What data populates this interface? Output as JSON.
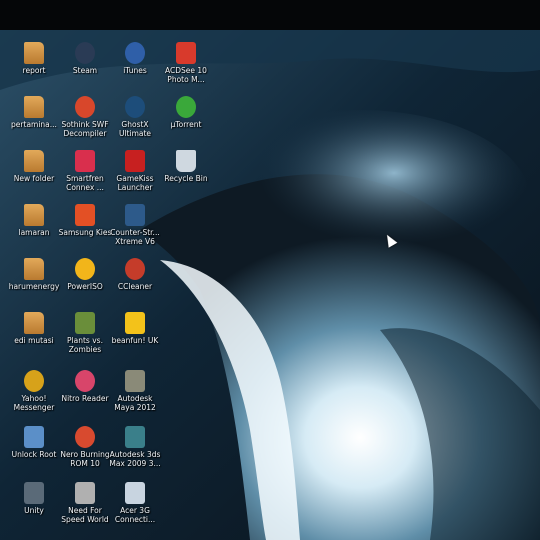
{
  "desktop": {
    "icons": [
      {
        "label": "report",
        "type": "folder",
        "color": "#d79a48",
        "icon": "folder-icon"
      },
      {
        "label": "Steam",
        "type": "app",
        "color": "#2a3b55",
        "icon": "steam-icon"
      },
      {
        "label": "iTunes",
        "type": "app",
        "color": "#2f5fa8",
        "icon": "itunes-icon"
      },
      {
        "label": "ACDSee 10 Photo M...",
        "type": "app",
        "color": "#d83a2c",
        "icon": "acdsee-icon"
      },
      {
        "label": "pertamina...",
        "type": "folder",
        "color": "#d79a48",
        "icon": "folder-icon"
      },
      {
        "label": "Sothink SWF Decompiler",
        "type": "app",
        "color": "#d8472b",
        "icon": "sothink-icon"
      },
      {
        "label": "GhostX Ultimate",
        "type": "app",
        "color": "#1d4d7a",
        "icon": "ghostx-icon"
      },
      {
        "label": "µTorrent",
        "type": "app",
        "color": "#3aa83a",
        "icon": "utorrent-icon"
      },
      {
        "label": "New folder",
        "type": "folder",
        "color": "#d79a48",
        "icon": "folder-icon"
      },
      {
        "label": "Smartfren Connex ...",
        "type": "app",
        "color": "#d92f4d",
        "icon": "smartfren-icon"
      },
      {
        "label": "GameKiss Launcher",
        "type": "app",
        "color": "#c72020",
        "icon": "gamekiss-icon"
      },
      {
        "label": "Recycle Bin",
        "type": "app",
        "color": "#cfd8e0",
        "icon": "recycle-bin-icon"
      },
      {
        "label": "lamaran",
        "type": "folder",
        "color": "#d79a48",
        "icon": "folder-icon"
      },
      {
        "label": "Samsung Kies",
        "type": "app",
        "color": "#e35025",
        "icon": "samsung-kies-icon"
      },
      {
        "label": "Counter-Str... Xtreme V6",
        "type": "app",
        "color": "#2d5a8a",
        "icon": "counter-strike-icon"
      },
      {
        "label": "harumenergy",
        "type": "folder",
        "color": "#d79a48",
        "icon": "folder-icon"
      },
      {
        "label": "PowerISO",
        "type": "app",
        "color": "#f2b51a",
        "icon": "poweriso-icon"
      },
      {
        "label": "CCleaner",
        "type": "app",
        "color": "#c53c2a",
        "icon": "ccleaner-icon"
      },
      {
        "label": "edi mutasi",
        "type": "folder",
        "color": "#d79a48",
        "icon": "folder-icon"
      },
      {
        "label": "Plants vs. Zombies",
        "type": "app",
        "color": "#6a8e3a",
        "icon": "plants-vs-zombies-icon"
      },
      {
        "label": "beanfun! UK",
        "type": "app",
        "color": "#f3c21a",
        "icon": "beanfun-icon"
      },
      {
        "label": "Yahoo! Messenger",
        "type": "app",
        "color": "#d7a21a",
        "icon": "yahoo-messenger-icon"
      },
      {
        "label": "Nitro Reader",
        "type": "app",
        "color": "#d8456a",
        "icon": "nitro-reader-icon"
      },
      {
        "label": "Autodesk Maya 2012",
        "type": "app",
        "color": "#8a8a78",
        "icon": "maya-icon"
      },
      {
        "label": "Unlock Root",
        "type": "app",
        "color": "#5b8fc8",
        "icon": "unlock-root-icon"
      },
      {
        "label": "Nero Burning ROM 10",
        "type": "app",
        "color": "#d84a2f",
        "icon": "nero-icon"
      },
      {
        "label": "Autodesk 3ds Max 2009 3...",
        "type": "app",
        "color": "#3a7f8a",
        "icon": "3ds-max-icon"
      },
      {
        "label": "Unity",
        "type": "app",
        "color": "#5a6a78",
        "icon": "unity-icon"
      },
      {
        "label": "Need For Speed World",
        "type": "app",
        "color": "#b0b0b0",
        "icon": "nfs-world-icon"
      },
      {
        "label": "Acer 3G Connecti...",
        "type": "app",
        "color": "#c8d4e0",
        "icon": "acer-3g-icon"
      }
    ]
  },
  "wallpaper": {
    "colors": [
      "#0d1b26",
      "#2d4d63",
      "#93b7cc",
      "#ffffff"
    ]
  }
}
